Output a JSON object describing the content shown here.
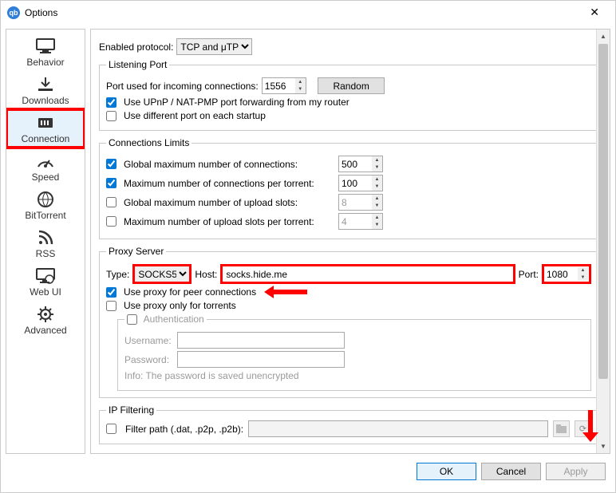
{
  "window": {
    "title": "Options"
  },
  "sidebar": {
    "items": [
      {
        "label": "Behavior"
      },
      {
        "label": "Downloads"
      },
      {
        "label": "Connection"
      },
      {
        "label": "Speed"
      },
      {
        "label": "BitTorrent"
      },
      {
        "label": "RSS"
      },
      {
        "label": "Web UI"
      },
      {
        "label": "Advanced"
      }
    ]
  },
  "protocol": {
    "label": "Enabled protocol:",
    "value": "TCP and μTP"
  },
  "listening": {
    "legend": "Listening Port",
    "port_label": "Port used for incoming connections:",
    "port_value": "1556",
    "random": "Random",
    "upnp": "Use UPnP / NAT-PMP port forwarding from my router",
    "diff_port": "Use different port on each startup"
  },
  "limits": {
    "legend": "Connections Limits",
    "c1": {
      "label": "Global maximum number of connections:",
      "val": "500"
    },
    "c2": {
      "label": "Maximum number of connections per torrent:",
      "val": "100"
    },
    "c3": {
      "label": "Global maximum number of upload slots:",
      "val": "8"
    },
    "c4": {
      "label": "Maximum number of upload slots per torrent:",
      "val": "4"
    }
  },
  "proxy": {
    "legend": "Proxy Server",
    "type_label": "Type:",
    "type_value": "SOCKS5",
    "host_label": "Host:",
    "host_value": "socks.hide.me",
    "port_label": "Port:",
    "port_value": "1080",
    "peer": "Use proxy for peer connections",
    "torrents_only": "Use proxy only for torrents",
    "auth": "Authentication",
    "user_label": "Username:",
    "user_value": "",
    "pass_label": "Password:",
    "pass_value": "",
    "info": "Info: The password is saved unencrypted"
  },
  "ipfilter": {
    "legend": "IP Filtering",
    "path_label": "Filter path (.dat, .p2p, .p2b):",
    "path_value": ""
  },
  "footer": {
    "ok": "OK",
    "cancel": "Cancel",
    "apply": "Apply"
  }
}
